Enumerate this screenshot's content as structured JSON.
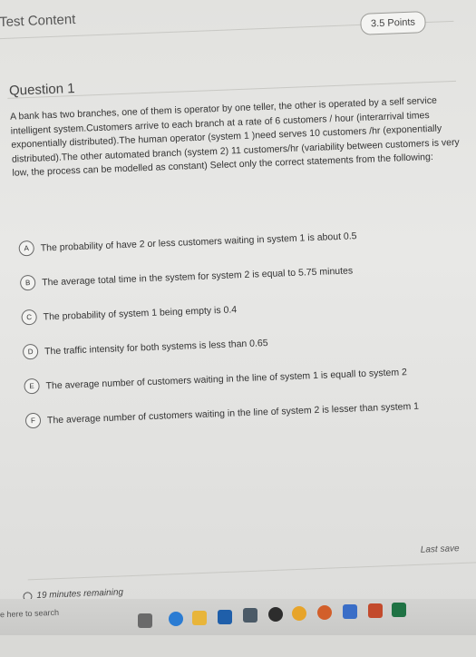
{
  "header": {
    "title": "Test Content",
    "points": "3.5 Points"
  },
  "question": {
    "title": "Question 1",
    "text": "A bank has two branches, one of them is operator by one teller, the other is operated by a self service intelligent system.Customers arrive to each branch at a rate of 6 customers / hour (interarrival times exponentially distributed).The human operator (system 1 )need serves 10 customers /hr (exponentially distributed).The other automated branch (system 2) 11 customers/hr (variability between customers is very low, the process can be modelled as constant) Select only the correct statements from the following:",
    "options": [
      {
        "letter": "A",
        "text": "The probability of have 2 or less customers waiting in system 1 is about 0.5"
      },
      {
        "letter": "B",
        "text": "The average total time in the system for system 2 is equal to 5.75 minutes"
      },
      {
        "letter": "C",
        "text": "The probability of system 1 being empty is 0.4"
      },
      {
        "letter": "D",
        "text": "The traffic intensity for both systems is less than 0.65"
      },
      {
        "letter": "E",
        "text": "The average number of customers waiting in the line of system 1 is equall to system 2"
      },
      {
        "letter": "F",
        "text": "The average number of customers waiting in the line of system 2 is lesser than system 1"
      }
    ]
  },
  "footer": {
    "timer": "19 minutes remaining",
    "last_saved": "Last save"
  },
  "taskbar": {
    "search": "e here to search"
  }
}
